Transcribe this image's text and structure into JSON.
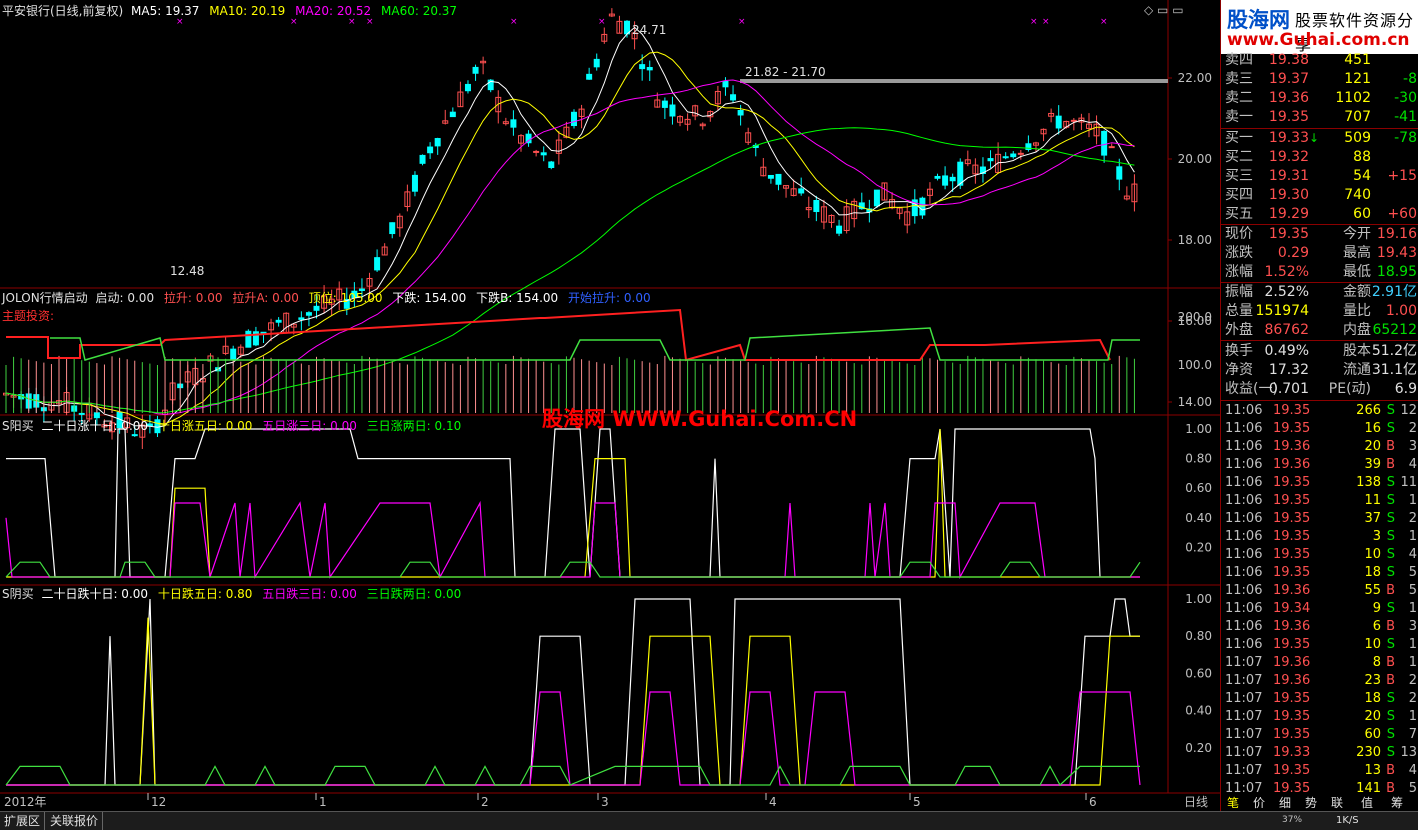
{
  "main_chart": {
    "title": "平安银行(日线,前复权)",
    "ma5": "MA5: 19.37",
    "ma10": "MA10: 20.19",
    "ma20": "MA20: 20.52",
    "ma60": "MA60: 20.37",
    "high_label": "24.71",
    "range_label": "21.82 - 21.70",
    "low_label": "12.48",
    "y_ticks": [
      "22.00",
      "20.00",
      "18.00",
      "16.00",
      "14.00"
    ],
    "axis_date": "2012年",
    "months": [
      "12",
      "1",
      "2",
      "3",
      "4",
      "5",
      "6"
    ],
    "period": "日线"
  },
  "indicator1": {
    "name": "JOLON行情启动",
    "fields": [
      "启动: 0.00",
      "拉升: 0.00",
      "拉升A: 0.00",
      "顶位: 105.00",
      "下跌: 154.00",
      "下跌B: 154.00",
      "开始拉升: 0.00"
    ],
    "note": "主题投资:",
    "y_ticks": [
      "200.0",
      "100.0"
    ]
  },
  "indicator2": {
    "name": "S阳买",
    "fields": [
      "二十日涨十日: 0.00",
      "十日涨五日: 0.00",
      "五日涨三日: 0.00",
      "三日涨两日: 0.10"
    ],
    "y_ticks": [
      "1.00",
      "0.80",
      "0.60",
      "0.40",
      "0.20"
    ]
  },
  "indicator3": {
    "name": "S阴买",
    "fields": [
      "二十日跌十日: 0.00",
      "十日跌五日: 0.80",
      "五日跌三日: 0.00",
      "三日跌两日: 0.00"
    ],
    "y_ticks": [
      "1.00",
      "0.80",
      "0.60",
      "0.40",
      "0.20"
    ]
  },
  "watermark": "股海网 WWW.Guhai.Com.CN",
  "logo": {
    "brand": "股海网",
    "slogan": "股票软件资源分享",
    "url": "www.Guhai.com.cn"
  },
  "order_book": {
    "asks": [
      {
        "label": "卖四",
        "price": "19.38",
        "vol": "451",
        "chg": ""
      },
      {
        "label": "卖三",
        "price": "19.37",
        "vol": "121",
        "chg": "-8"
      },
      {
        "label": "卖二",
        "price": "19.36",
        "vol": "1102",
        "chg": "-30"
      },
      {
        "label": "卖一",
        "price": "19.35",
        "vol": "707",
        "chg": "-41"
      }
    ],
    "bids": [
      {
        "label": "买一",
        "price": "19.33",
        "vol": "509",
        "chg": "-78"
      },
      {
        "label": "买二",
        "price": "19.32",
        "vol": "88",
        "chg": ""
      },
      {
        "label": "买三",
        "price": "19.31",
        "vol": "54",
        "chg": "+15"
      },
      {
        "label": "买四",
        "price": "19.30",
        "vol": "740",
        "chg": ""
      },
      {
        "label": "买五",
        "price": "19.29",
        "vol": "60",
        "chg": "+60"
      }
    ]
  },
  "quote": [
    {
      "l1": "现价",
      "v1": "19.35",
      "l2": "今开",
      "v2": "19.16"
    },
    {
      "l1": "涨跌",
      "v1": "0.29",
      "l2": "最高",
      "v2": "19.43"
    },
    {
      "l1": "涨幅",
      "v1": "1.52%",
      "l2": "最低",
      "v2": "18.95"
    },
    {
      "l1": "振幅",
      "v1": "2.52%",
      "l2": "金额",
      "v2": "2.91亿"
    },
    {
      "l1": "总量",
      "v1": "151974",
      "l2": "量比",
      "v2": "1.00"
    },
    {
      "l1": "外盘",
      "v1": "86762",
      "l2": "内盘",
      "v2": "65212"
    },
    {
      "l1": "换手",
      "v1": "0.49%",
      "l2": "股本",
      "v2": "51.2亿"
    },
    {
      "l1": "净资",
      "v1": "17.32",
      "l2": "流通",
      "v2": "31.1亿"
    },
    {
      "l1": "收益(一)",
      "v1": "0.701",
      "l2": "PE(动)",
      "v2": "6.9"
    }
  ],
  "ticks": [
    {
      "t": "11:06",
      "p": "19.35",
      "v": "266",
      "s": "S",
      "n": "12"
    },
    {
      "t": "11:06",
      "p": "19.35",
      "v": "16",
      "s": "S",
      "n": "2"
    },
    {
      "t": "11:06",
      "p": "19.36",
      "v": "20",
      "s": "B",
      "n": "3"
    },
    {
      "t": "11:06",
      "p": "19.36",
      "v": "39",
      "s": "B",
      "n": "4"
    },
    {
      "t": "11:06",
      "p": "19.35",
      "v": "138",
      "s": "S",
      "n": "11"
    },
    {
      "t": "11:06",
      "p": "19.35",
      "v": "11",
      "s": "S",
      "n": "1"
    },
    {
      "t": "11:06",
      "p": "19.35",
      "v": "37",
      "s": "S",
      "n": "2"
    },
    {
      "t": "11:06",
      "p": "19.35",
      "v": "3",
      "s": "S",
      "n": "1"
    },
    {
      "t": "11:06",
      "p": "19.35",
      "v": "10",
      "s": "S",
      "n": "4"
    },
    {
      "t": "11:06",
      "p": "19.35",
      "v": "18",
      "s": "S",
      "n": "5"
    },
    {
      "t": "11:06",
      "p": "19.36",
      "v": "55",
      "s": "B",
      "n": "5"
    },
    {
      "t": "11:06",
      "p": "19.34",
      "v": "9",
      "s": "S",
      "n": "1"
    },
    {
      "t": "11:06",
      "p": "19.36",
      "v": "6",
      "s": "B",
      "n": "3"
    },
    {
      "t": "11:06",
      "p": "19.35",
      "v": "10",
      "s": "S",
      "n": "1"
    },
    {
      "t": "11:07",
      "p": "19.36",
      "v": "8",
      "s": "B",
      "n": "1"
    },
    {
      "t": "11:07",
      "p": "19.36",
      "v": "23",
      "s": "B",
      "n": "2"
    },
    {
      "t": "11:07",
      "p": "19.35",
      "v": "18",
      "s": "S",
      "n": "2"
    },
    {
      "t": "11:07",
      "p": "19.35",
      "v": "20",
      "s": "S",
      "n": "1"
    },
    {
      "t": "11:07",
      "p": "19.35",
      "v": "60",
      "s": "S",
      "n": "7"
    },
    {
      "t": "11:07",
      "p": "19.33",
      "v": "230",
      "s": "S",
      "n": "13"
    },
    {
      "t": "11:07",
      "p": "19.35",
      "v": "13",
      "s": "B",
      "n": "4"
    },
    {
      "t": "11:07",
      "p": "19.35",
      "v": "141",
      "s": "B",
      "n": "5"
    }
  ],
  "bottom_tabs": [
    "扩展区",
    "关联报价"
  ],
  "right_tabs": [
    "笔",
    "价",
    "细",
    "势",
    "联",
    "值",
    "筹"
  ],
  "status": {
    "zoom": "37%",
    "speed": "1K/S"
  },
  "colors": {
    "up": "#ff5050",
    "down": "#00ffff",
    "ma5": "#ffffff",
    "ma10": "#ffff00",
    "ma20": "#ff00ff",
    "ma60": "#00ff00",
    "grid": "#8b0000"
  }
}
